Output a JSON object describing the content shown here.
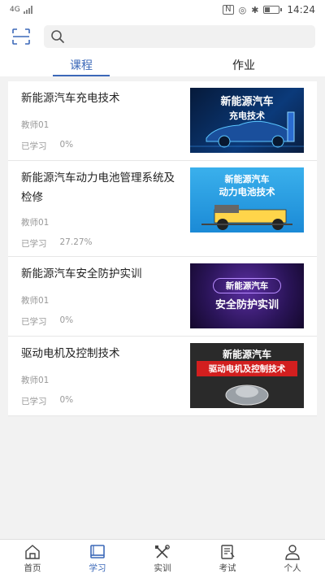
{
  "status": {
    "network": "4G",
    "battery_percent": 0.35,
    "time": "14:24"
  },
  "search": {
    "placeholder": "",
    "value": ""
  },
  "tabs": [
    {
      "label": "课程",
      "active": true
    },
    {
      "label": "作业",
      "active": false
    }
  ],
  "courses": [
    {
      "title": "新能源汽车充电技术",
      "teacher": "教师01",
      "progress_label": "已学习",
      "progress": "0%",
      "thumb": {
        "line1": "新能源汽车",
        "line2": "充电技术"
      }
    },
    {
      "title": "新能源汽车动力电池管理系统及检修",
      "teacher": "教师01",
      "progress_label": "已学习",
      "progress": "27.27%",
      "thumb": {
        "line1": "新能源汽车",
        "line2": "动力电池技术"
      }
    },
    {
      "title": "新能源汽车安全防护实训",
      "teacher": "教师01",
      "progress_label": "已学习",
      "progress": "0%",
      "thumb": {
        "line1": "新能源汽车",
        "line2": "安全防护实训"
      }
    },
    {
      "title": "驱动电机及控制技术",
      "teacher": "教师01",
      "progress_label": "已学习",
      "progress": "0%",
      "thumb": {
        "line1": "新能源汽车",
        "line2": "驱动电机及控制技术"
      }
    }
  ],
  "nav": [
    {
      "label": "首页",
      "icon": "home-icon",
      "active": false
    },
    {
      "label": "学习",
      "icon": "book-icon",
      "active": true
    },
    {
      "label": "实训",
      "icon": "tools-icon",
      "active": false
    },
    {
      "label": "考试",
      "icon": "exam-icon",
      "active": false
    },
    {
      "label": "个人",
      "icon": "person-icon",
      "active": false
    }
  ],
  "colors": {
    "accent": "#3b68b8",
    "background": "#f2f2f2"
  }
}
